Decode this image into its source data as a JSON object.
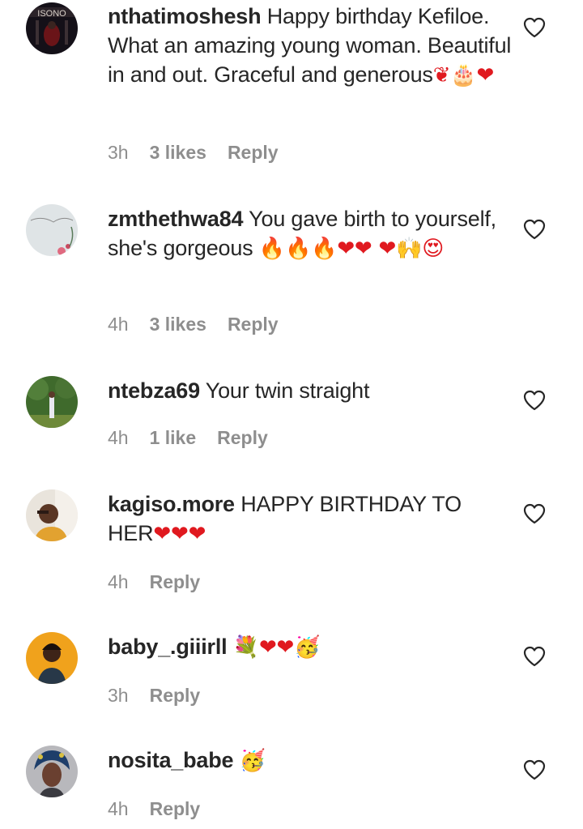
{
  "comments": [
    {
      "username": "nthatimoshesh",
      "text": "Happy birthday Kefiloe. What an amazing young woman. Beautiful in and out. Graceful and generous",
      "emojis": "❦🎂❤",
      "time": "3h",
      "likes": "3 likes",
      "reply": "Reply",
      "avatar_label": "ISONO"
    },
    {
      "username": "zmthethwa84",
      "text": "You gave birth to yourself, she's gorgeous",
      "emojis": "🔥🔥🔥❤❤ ❤🙌😍",
      "time": "4h",
      "likes": "3 likes",
      "reply": "Reply"
    },
    {
      "username": "ntebza69",
      "text": "Your twin straight",
      "time": "4h",
      "likes": "1 like",
      "reply": "Reply"
    },
    {
      "username": "kagiso.more",
      "text": "HAPPY BIRTHDAY TO HER",
      "emojis": "❤❤❤",
      "time": "4h",
      "reply": "Reply"
    },
    {
      "username": "baby_.giiirll",
      "text": "",
      "emojis": "💐❤❤🥳",
      "time": "3h",
      "reply": "Reply"
    },
    {
      "username": "nosita_babe",
      "text": "",
      "emojis": "🥳",
      "time": "4h",
      "reply": "Reply"
    }
  ],
  "icons": {
    "like": "heart-outline-icon"
  },
  "colors": {
    "username": "#262626",
    "meta": "#8e8e8e",
    "heart": "#e0191f"
  }
}
